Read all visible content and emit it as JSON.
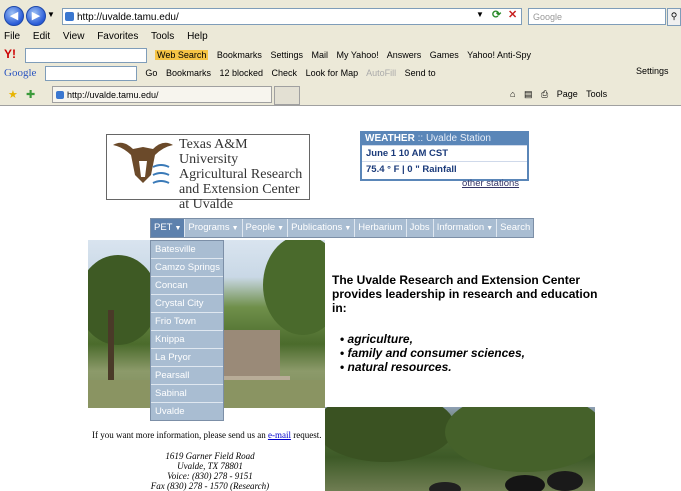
{
  "browser": {
    "address": "http://uvalde.tamu.edu/",
    "search_placeholder": "Google",
    "menu": [
      "File",
      "Edit",
      "View",
      "Favorites",
      "Tools",
      "Help"
    ],
    "yahoo_toolbar": [
      "Web Search",
      "Bookmarks",
      "Settings",
      "Mail",
      "My Yahoo!",
      "Answers",
      "Games",
      "Yahoo! Anti-Spy"
    ],
    "google_toolbar": [
      "Google",
      "Go",
      "Bookmarks",
      "12 blocked",
      "Check",
      "Look for Map",
      "AutoFill",
      "Send to",
      "Settings"
    ],
    "tab_title": "http://uvalde.tamu.edu/",
    "command_bar": [
      "Page",
      "Tools"
    ]
  },
  "logo": {
    "line1": "Texas A&M University",
    "line2": "Agricultural Research",
    "line3": "and Extension Center",
    "line4": "at Uvalde"
  },
  "weather": {
    "title": "WEATHER",
    "sep": " :: ",
    "station": "Uvalde Station",
    "datetime": "June 1 10 AM CST",
    "reading": "75.4 ° F   |   0 \" Rainfall",
    "other_link": "other stations"
  },
  "nav": [
    {
      "label": "PET",
      "has_menu": true
    },
    {
      "label": "Programs",
      "has_menu": true
    },
    {
      "label": "People",
      "has_menu": true
    },
    {
      "label": "Publications",
      "has_menu": true
    },
    {
      "label": "Herbarium",
      "has_menu": false
    },
    {
      "label": "Jobs",
      "has_menu": false
    },
    {
      "label": "Information",
      "has_menu": true
    },
    {
      "label": "Search",
      "has_menu": false
    }
  ],
  "pet_dropdown": [
    "Batesville",
    "Camzo Springs",
    "Concan",
    "Crystal City",
    "Frio Town",
    "Knippa",
    "La Pryor",
    "Pearsall",
    "Sabinal",
    "Uvalde"
  ],
  "content": {
    "intro": "The Uvalde Research and Extension Center provides leadership in research and education in:",
    "bullets": [
      "agriculture,",
      "family and consumer sciences,",
      "natural resources."
    ],
    "info_prefix": "If you want more information, please send us an ",
    "info_link": "e-mail",
    "info_suffix": " request.",
    "address": [
      "1619 Garner Field Road",
      "Uvalde, TX 78801",
      "Voice: (830) 278 - 9151",
      "Fax (830) 278 - 1570 (Research)"
    ]
  },
  "colors": {
    "nav_bg": "#a9bdd2",
    "nav_active": "#5d81ad",
    "weather_border": "#5a86b8"
  }
}
